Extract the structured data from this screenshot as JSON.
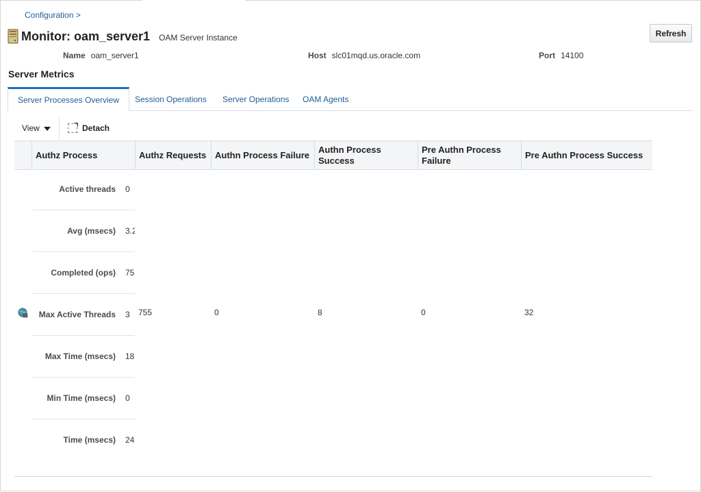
{
  "breadcrumb": "Configuration >",
  "header": {
    "title": "Monitor: oam_server1",
    "subtitle": "OAM Server Instance",
    "refresh_label": "Refresh"
  },
  "info": {
    "name_label": "Name",
    "name_value": "oam_server1",
    "host_label": "Host",
    "host_value": "slc01mqd.us.oracle.com",
    "port_label": "Port",
    "port_value": "14100"
  },
  "section_title": "Server Metrics",
  "tabs": [
    {
      "label": "Server Processes Overview",
      "active": true
    },
    {
      "label": "Session Operations",
      "active": false
    },
    {
      "label": "Server Operations",
      "active": false
    },
    {
      "label": "OAM Agents",
      "active": false
    }
  ],
  "toolbar": {
    "view_label": "View",
    "detach_label": "Detach"
  },
  "table": {
    "headers": [
      "Authz Process",
      "Authz Requests",
      "Authn Process Failure",
      "Authn Process Success",
      "Pre Authn Process Failure",
      "Pre Authn Process Success"
    ],
    "authz_metrics": [
      {
        "label": "Active threads",
        "value": "0"
      },
      {
        "label": "Avg (msecs)",
        "value": "3.2"
      },
      {
        "label": "Completed (ops)",
        "value": "75"
      },
      {
        "label": "Max Active Threads",
        "value": "3"
      },
      {
        "label": "Max Time (msecs)",
        "value": "18"
      },
      {
        "label": "Min Time (msecs)",
        "value": "0"
      },
      {
        "label": "Time (msecs)",
        "value": "24"
      }
    ],
    "row_values": [
      "755",
      "0",
      "8",
      "0",
      "32"
    ]
  },
  "colors": {
    "link": "#1f5d99",
    "tab_active_border": "#1f6fb8",
    "header_bg": "#f4f5f7"
  }
}
